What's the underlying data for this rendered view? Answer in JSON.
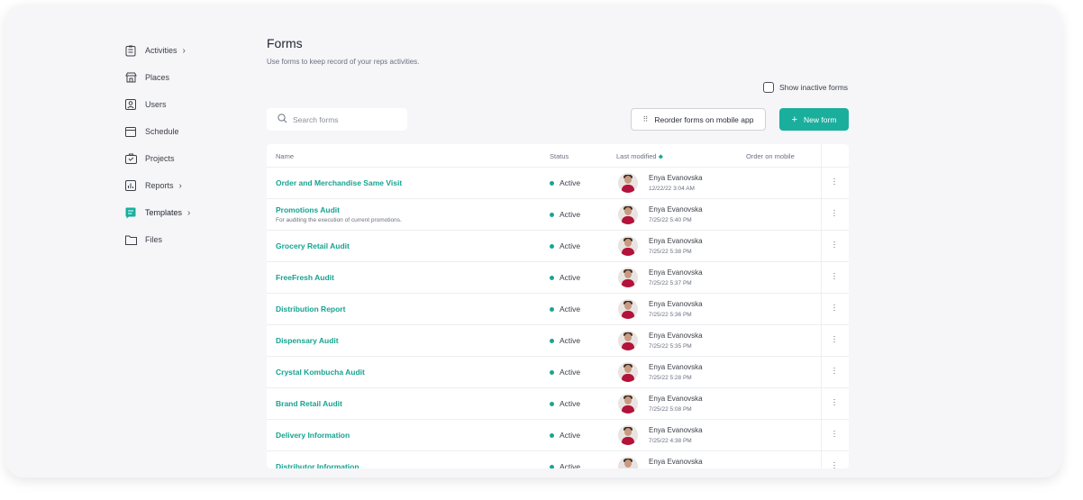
{
  "sidebar": {
    "items": [
      {
        "label": "Activities",
        "icon": "activities-icon",
        "chevron": true
      },
      {
        "label": "Places",
        "icon": "store-icon",
        "chevron": false
      },
      {
        "label": "Users",
        "icon": "user-icon",
        "chevron": false
      },
      {
        "label": "Schedule",
        "icon": "calendar-icon",
        "chevron": false
      },
      {
        "label": "Projects",
        "icon": "projects-icon",
        "chevron": false
      },
      {
        "label": "Reports",
        "icon": "reports-icon",
        "chevron": true
      },
      {
        "label": "Templates",
        "icon": "templates-icon",
        "chevron": true
      },
      {
        "label": "Files",
        "icon": "folder-icon",
        "chevron": false
      }
    ]
  },
  "page": {
    "title": "Forms",
    "subtitle": "Use forms to keep record of your reps activities."
  },
  "controls": {
    "show_inactive_label": "Show inactive forms",
    "search_placeholder": "Search forms",
    "reorder_label": "Reorder forms on mobile app",
    "new_form_label": "New form"
  },
  "table": {
    "headers": {
      "name": "Name",
      "status": "Status",
      "last_modified": "Last modified",
      "order_on_mobile": "Order on mobile"
    },
    "rows": [
      {
        "name": "Order and Merchandise Same Visit",
        "description": "",
        "status": "Active",
        "user": "Enya Evanovska",
        "date": "12/22/22 3:04 AM"
      },
      {
        "name": "Promotions Audit",
        "description": "For auditing the execution of current promotions.",
        "status": "Active",
        "user": "Enya Evanovska",
        "date": "7/25/22 5:40 PM"
      },
      {
        "name": "Grocery Retail Audit",
        "description": "",
        "status": "Active",
        "user": "Enya Evanovska",
        "date": "7/25/22 5:38 PM"
      },
      {
        "name": "FreeFresh Audit",
        "description": "",
        "status": "Active",
        "user": "Enya Evanovska",
        "date": "7/25/22 5:37 PM"
      },
      {
        "name": "Distribution Report",
        "description": "",
        "status": "Active",
        "user": "Enya Evanovska",
        "date": "7/25/22 5:36 PM"
      },
      {
        "name": "Dispensary Audit",
        "description": "",
        "status": "Active",
        "user": "Enya Evanovska",
        "date": "7/25/22 5:35 PM"
      },
      {
        "name": "Crystal Kombucha Audit",
        "description": "",
        "status": "Active",
        "user": "Enya Evanovska",
        "date": "7/25/22 5:28 PM"
      },
      {
        "name": "Brand Retail Audit",
        "description": "",
        "status": "Active",
        "user": "Enya Evanovska",
        "date": "7/25/22 5:08 PM"
      },
      {
        "name": "Delivery Information",
        "description": "",
        "status": "Active",
        "user": "Enya Evanovska",
        "date": "7/25/22 4:38 PM"
      },
      {
        "name": "Distributor Information",
        "description": "",
        "status": "Active",
        "user": "Enya Evanovska",
        "date": ""
      }
    ]
  },
  "colors": {
    "accent": "#1aaf9d",
    "link": "#16a390",
    "status_active": "#1aa593",
    "avatar_shirt": "#b3123a"
  }
}
